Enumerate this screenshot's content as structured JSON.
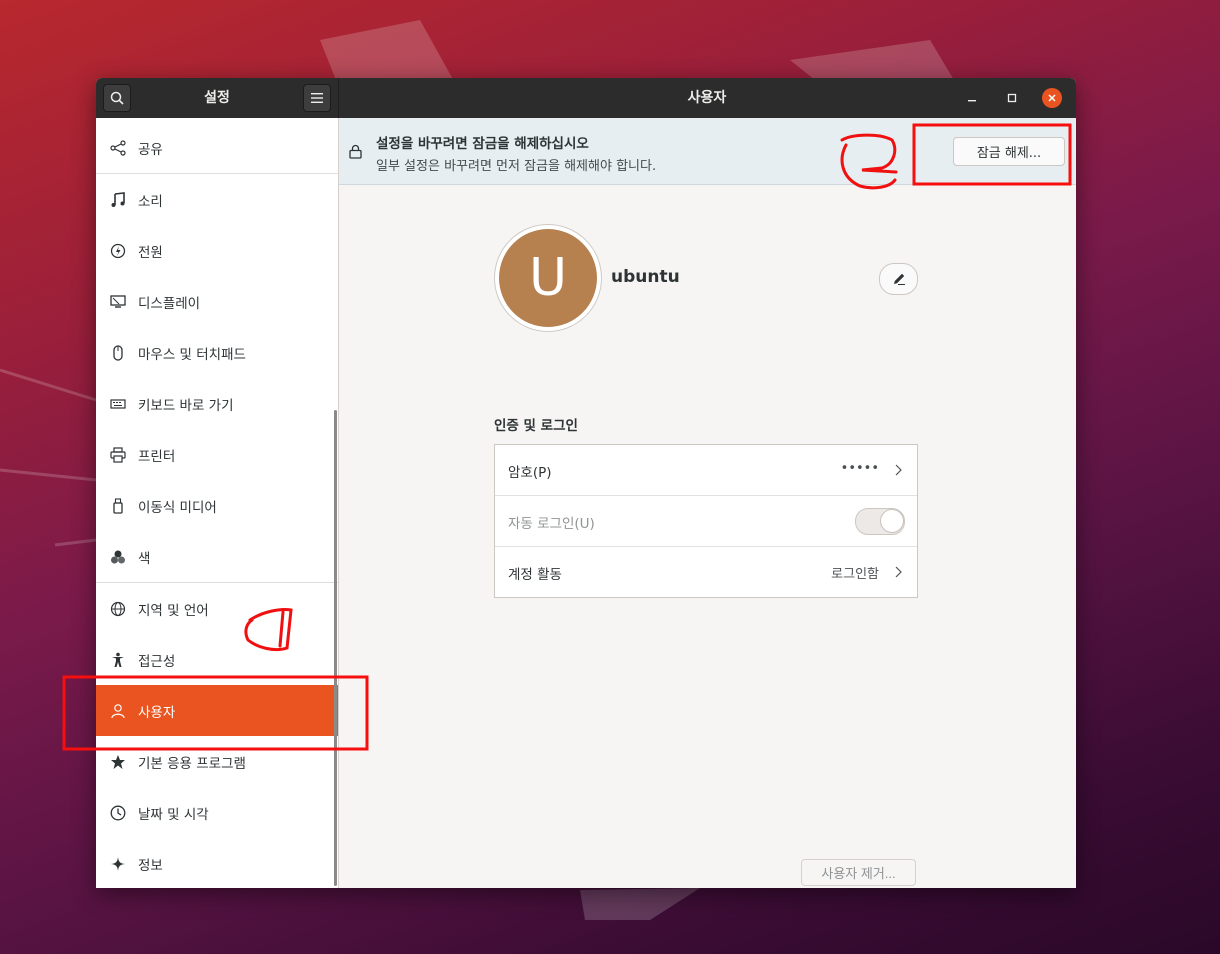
{
  "window": {
    "sidebar_title": "설정",
    "main_title": "사용자"
  },
  "sidebar": {
    "items": [
      {
        "label": "공유",
        "icon": "share-icon"
      },
      {
        "label": "소리",
        "icon": "music-note-icon"
      },
      {
        "label": "전원",
        "icon": "power-icon"
      },
      {
        "label": "디스플레이",
        "icon": "display-icon"
      },
      {
        "label": "마우스 및 터치패드",
        "icon": "mouse-icon"
      },
      {
        "label": "키보드 바로 가기",
        "icon": "keyboard-icon"
      },
      {
        "label": "프린터",
        "icon": "printer-icon"
      },
      {
        "label": "이동식 미디어",
        "icon": "removable-media-icon"
      },
      {
        "label": "색",
        "icon": "color-icon"
      },
      {
        "label": "지역 및 언어",
        "icon": "globe-icon"
      },
      {
        "label": "접근성",
        "icon": "accessibility-icon"
      },
      {
        "label": "사용자",
        "icon": "user-icon",
        "active": true
      },
      {
        "label": "기본 응용 프로그램",
        "icon": "star-icon"
      },
      {
        "label": "날짜 및 시각",
        "icon": "clock-icon"
      },
      {
        "label": "정보",
        "icon": "sparkle-icon"
      }
    ]
  },
  "infobar": {
    "title": "설정을 바꾸려면 잠금을 해제하십시오",
    "subtitle": "일부 설정은 바꾸려면 먼저 잠금을 해제해야 합니다.",
    "unlock_label": "잠금 해제..."
  },
  "user": {
    "avatar_letter": "U",
    "name": "ubuntu"
  },
  "auth_section": {
    "heading": "인증 및 로그인",
    "password_label": "암호(P)",
    "password_value": "•••••",
    "autologin_label": "자동 로그인(U)",
    "autologin_on": false,
    "activity_label": "계정 활동",
    "activity_value": "로그인함"
  },
  "remove_user_label": "사용자 제거...",
  "colors": {
    "accent": "#e95420",
    "annotation": "#ff0000"
  }
}
